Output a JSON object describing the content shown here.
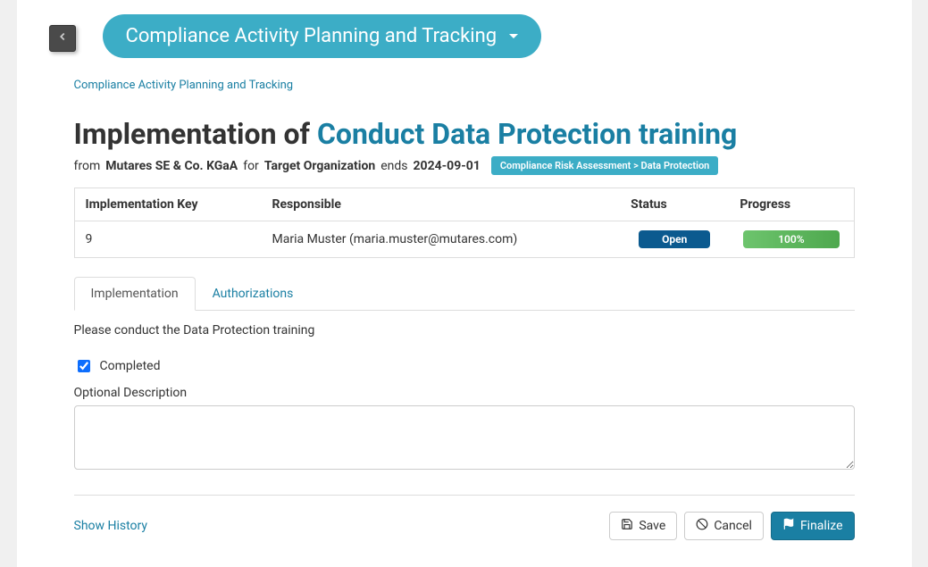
{
  "header": {
    "dropdown_label": "Compliance Activity Planning and Tracking",
    "breadcrumb": "Compliance Activity Planning and Tracking"
  },
  "title": {
    "prefix": "Implementation of",
    "highlight": "Conduct Data Protection training"
  },
  "subline": {
    "from_label": "from",
    "from_org": "Mutares SE & Co. KGaA",
    "for_label": "for",
    "for_org": "Target Organization",
    "ends_label": "ends",
    "ends_date": "2024-09-01",
    "badge": "Compliance Risk Assessment > Data Protection"
  },
  "table": {
    "headers": {
      "key": "Implementation Key",
      "responsible": "Responsible",
      "status": "Status",
      "progress": "Progress"
    },
    "row": {
      "key": "9",
      "responsible": "Maria Muster (maria.muster@mutares.com)",
      "status": "Open",
      "progress": "100%"
    }
  },
  "tabs": {
    "implementation": "Implementation",
    "authorizations": "Authorizations"
  },
  "body": {
    "instruction": "Please conduct the Data Protection training",
    "completed_label": "Completed",
    "desc_label": "Optional Description"
  },
  "footer": {
    "history": "Show History",
    "save": "Save",
    "cancel": "Cancel",
    "finalize": "Finalize"
  }
}
